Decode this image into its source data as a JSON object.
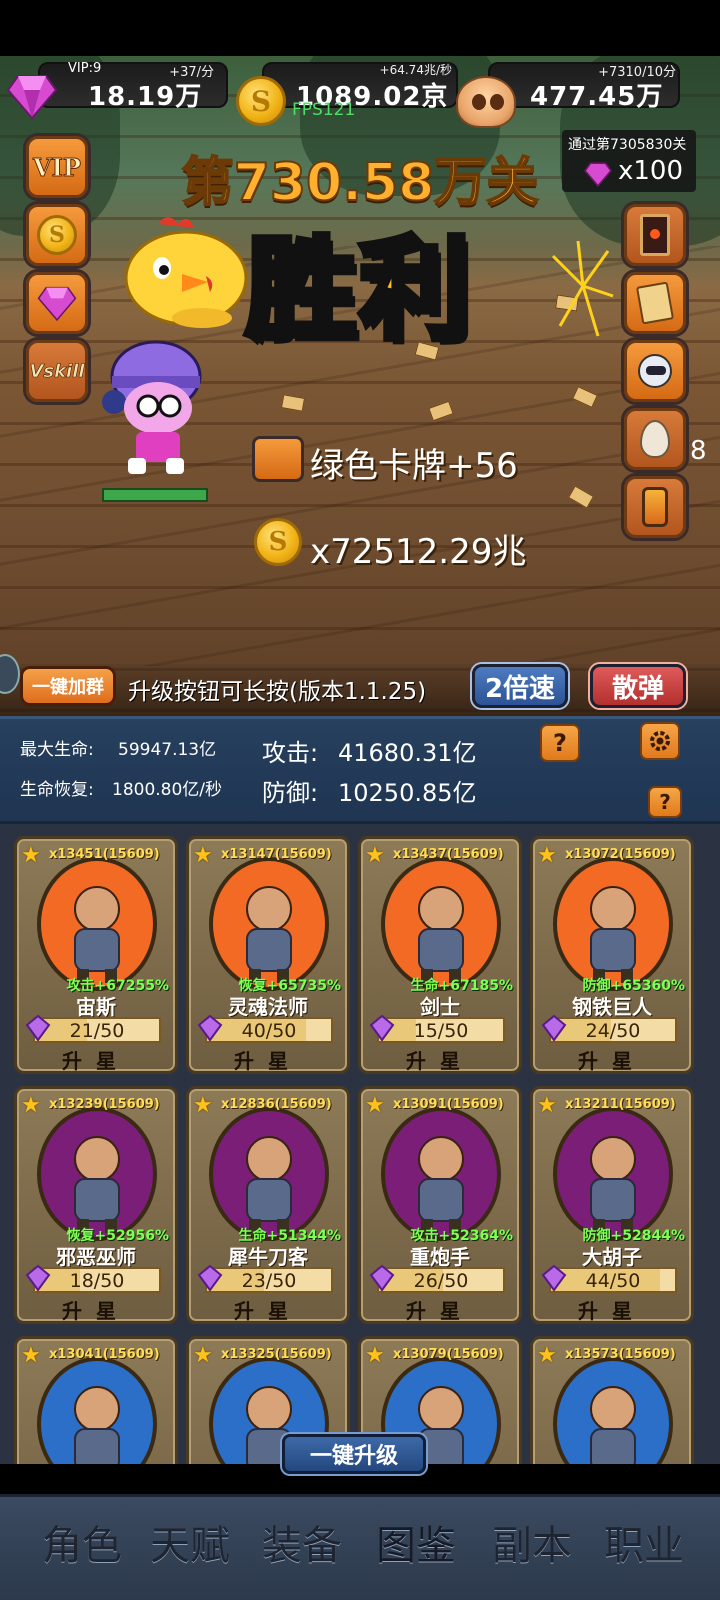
{
  "resources": {
    "vip": "VIP:9",
    "gems": "18.19万",
    "gems_rate": "+37/分",
    "coins": "1089.02京",
    "coins_rate": "+64.74兆/秒",
    "fps": "FPS121",
    "skulls": "477.45万",
    "skulls_rate": "+7310/10分"
  },
  "reward_box": {
    "label": "通过第7305830关",
    "gem_amount": "x100"
  },
  "left_buttons": [
    "VIP",
    "S",
    "gem",
    "Vskill"
  ],
  "battle": {
    "stage": "第730.58万关",
    "result": "胜利",
    "card_reward": "绿色卡牌+56",
    "coin_reward": "x72512.29兆",
    "edge_number": "8"
  },
  "controls": {
    "join_group": "一键加群",
    "notice": "升级按钮可长按(版本1.1.25)",
    "speed": "2倍速",
    "scatter": "散弹"
  },
  "stats": {
    "max_hp_label": "最大生命:",
    "max_hp": "59947.13亿",
    "regen_label": "生命恢复:",
    "regen": "1800.80亿/秒",
    "attack_label": "攻击:",
    "attack": "41680.31亿",
    "defense_label": "防御:",
    "defense": "10250.85亿",
    "help": "?"
  },
  "heroes": [
    {
      "count": "x13451(15609)",
      "bonus": "攻击+67255%",
      "name": "宙斯",
      "progress": "21/50",
      "fill": 0.42,
      "upgrade": "升星",
      "bg": "#f26a24"
    },
    {
      "count": "x13147(15609)",
      "bonus": "恢复+65735%",
      "name": "灵魂法师",
      "progress": "40/50",
      "fill": 0.8,
      "upgrade": "升星",
      "bg": "#f26a24"
    },
    {
      "count": "x13437(15609)",
      "bonus": "生命+67185%",
      "name": "剑士",
      "progress": "15/50",
      "fill": 0.3,
      "upgrade": "升星",
      "bg": "#f26a24"
    },
    {
      "count": "x13072(15609)",
      "bonus": "防御+65360%",
      "name": "钢铁巨人",
      "progress": "24/50",
      "fill": 0.48,
      "upgrade": "升星",
      "bg": "#f26a24"
    },
    {
      "count": "x13239(15609)",
      "bonus": "恢复+52956%",
      "name": "邪恶巫师",
      "progress": "18/50",
      "fill": 0.36,
      "upgrade": "升星",
      "bg": "#7a1e78"
    },
    {
      "count": "x12836(15609)",
      "bonus": "生命+51344%",
      "name": "犀牛刀客",
      "progress": "23/50",
      "fill": 0.46,
      "upgrade": "升星",
      "bg": "#7a1e78"
    },
    {
      "count": "x13091(15609)",
      "bonus": "攻击+52364%",
      "name": "重炮手",
      "progress": "26/50",
      "fill": 0.52,
      "upgrade": "升星",
      "bg": "#7a1e78"
    },
    {
      "count": "x13211(15609)",
      "bonus": "防御+52844%",
      "name": "大胡子",
      "progress": "44/50",
      "fill": 0.88,
      "upgrade": "升星",
      "bg": "#7a1e78"
    },
    {
      "count": "x13041(15609)",
      "bg": "#2b6fc8"
    },
    {
      "count": "x13325(15609)",
      "bg": "#2b6fc8"
    },
    {
      "count": "x13079(15609)",
      "bg": "#2b6fc8"
    },
    {
      "count": "x13573(15609)",
      "bg": "#2b6fc8"
    }
  ],
  "upgrade_all": "一键升级",
  "nav": [
    "角色",
    "天赋",
    "装备",
    "图鉴",
    "副本",
    "职业"
  ]
}
